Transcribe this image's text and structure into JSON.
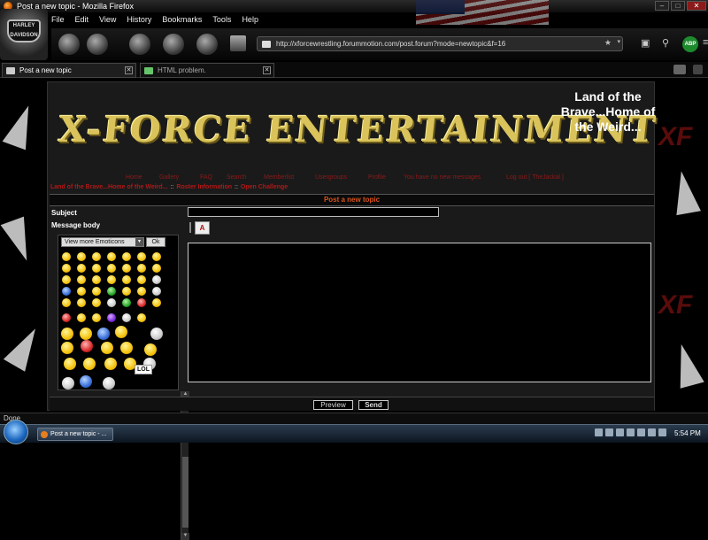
{
  "window": {
    "title": "Post a new topic - Mozilla Firefox"
  },
  "menu": [
    {
      "label": "File"
    },
    {
      "label": "Edit"
    },
    {
      "label": "View"
    },
    {
      "label": "History"
    },
    {
      "label": "Bookmarks"
    },
    {
      "label": "Tools"
    },
    {
      "label": "Help"
    }
  ],
  "urlbar": {
    "url": "http://xforcewrestling.forummotion.com/post.forum?mode=newtopic&f=16"
  },
  "toolbar_icons": [
    "wrench-icon",
    "gun-icon",
    "turbo-icon",
    "skull-icon",
    "harley-davidson-icon",
    "download-icon"
  ],
  "abp_label": "ABP",
  "tabs": [
    {
      "label": "Post a new topic",
      "active": true
    },
    {
      "label": "HTML problem.",
      "active": false
    }
  ],
  "forum": {
    "logo_text": "X-FORCE ENTERTAINMENT",
    "tagline": "Land of the Brave...Home of the Weird...",
    "nav": [
      {
        "label": "Home"
      },
      {
        "label": "Gallery"
      },
      {
        "label": "FAQ"
      },
      {
        "label": "Search"
      },
      {
        "label": "Memberlist"
      },
      {
        "label": "Usergroups"
      },
      {
        "label": "Profile"
      },
      {
        "label": "You have no new messages"
      },
      {
        "label": "Log out [ TheJackal ]"
      }
    ],
    "breadcrumbs": [
      {
        "label": "Land of the Brave...Home of the Weird..."
      },
      {
        "label": "Roster Information"
      },
      {
        "label": "Open Challenge"
      }
    ],
    "form_title": "Post a new topic",
    "subject_label": "Subject",
    "message_body_label": "Message body",
    "subject_value": "",
    "emoticons": {
      "selected": "View more Emoticons",
      "ok_label": "Ok",
      "sign_text": "LOL"
    },
    "preview_label": "Preview",
    "send_label": "Send"
  },
  "statusbar": {
    "text": "Done"
  },
  "taskbar": {
    "task_label": "Post a new topic - ...",
    "clock": "5:54 PM"
  },
  "colors": {
    "accent_orange": "#d7531b",
    "nav_red": "#8b1a1a",
    "logo_gold": "#d9c35a"
  }
}
